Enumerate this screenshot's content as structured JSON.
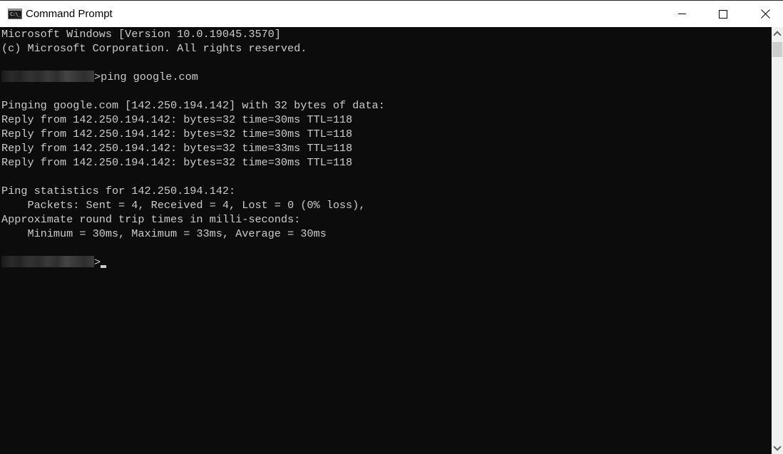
{
  "window": {
    "title": "Command Prompt",
    "icon": "cmd-icon",
    "icon_text": "C:\\_",
    "controls": {
      "minimize": "minimize-icon",
      "maximize": "maximize-icon",
      "close": "close-icon"
    }
  },
  "console": {
    "lines": [
      "Microsoft Windows [Version 10.0.19045.3570]",
      "(c) Microsoft Corporation. All rights reserved.",
      "",
      {
        "prompt_redacted": true,
        "text": ">ping google.com"
      },
      "",
      "Pinging google.com [142.250.194.142] with 32 bytes of data:",
      "Reply from 142.250.194.142: bytes=32 time=30ms TTL=118",
      "Reply from 142.250.194.142: bytes=32 time=30ms TTL=118",
      "Reply from 142.250.194.142: bytes=32 time=33ms TTL=118",
      "Reply from 142.250.194.142: bytes=32 time=30ms TTL=118",
      "",
      "Ping statistics for 142.250.194.142:",
      "    Packets: Sent = 4, Received = 4, Lost = 0 (0% loss),",
      "Approximate round trip times in milli-seconds:",
      "    Minimum = 30ms, Maximum = 33ms, Average = 30ms",
      "",
      {
        "prompt_redacted": true,
        "text": ">",
        "cursor": true
      }
    ],
    "colors": {
      "background": "#0c0c0c",
      "foreground": "#cccccc"
    }
  },
  "scrollbar": {
    "up": "scroll-up-icon",
    "down": "scroll-down-icon"
  }
}
